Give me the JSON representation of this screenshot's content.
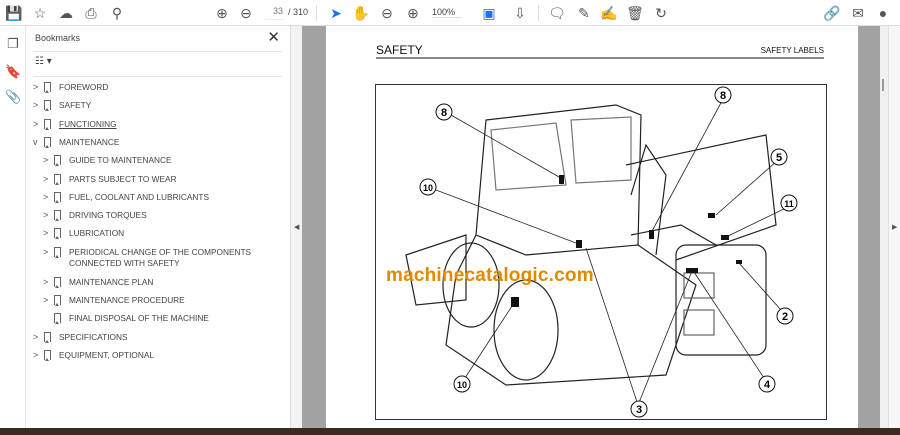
{
  "toolbar": {
    "icons": [
      "save-icon",
      "bookmark-star-icon",
      "upload-cloud-icon",
      "print-icon",
      "search-zoom-icon",
      "page-up-icon",
      "page-down-icon",
      "select-cursor-icon",
      "hand-icon",
      "zoom-out-icon",
      "zoom-in-icon",
      "fit-page-icon",
      "scroll-mode-icon",
      "comment-icon",
      "highlight-pen-icon",
      "sign-icon",
      "delete-icon",
      "rotate-icon",
      "share-link-icon",
      "email-icon",
      "account-icon"
    ],
    "current_page": "33",
    "total_pages": "/ 310",
    "zoom": "100%"
  },
  "bookmarks": {
    "title": "Bookmarks",
    "items": [
      {
        "label": "FOREWORD",
        "level": 0,
        "expand": ">"
      },
      {
        "label": "SAFETY",
        "level": 0,
        "expand": ">"
      },
      {
        "label": "FUNCTIONING",
        "level": 0,
        "expand": ">"
      },
      {
        "label": "MAINTENANCE",
        "level": 0,
        "expand": "v"
      },
      {
        "label": "GUIDE TO MAINTENANCE",
        "level": 1,
        "expand": ">"
      },
      {
        "label": "PARTS SUBJECT TO WEAR",
        "level": 1,
        "expand": ">"
      },
      {
        "label": "FUEL, COOLANT AND LUBRICANTS",
        "level": 1,
        "expand": ">"
      },
      {
        "label": "DRIVING TORQUES",
        "level": 1,
        "expand": ">"
      },
      {
        "label": "LUBRICATION",
        "level": 1,
        "expand": ">"
      },
      {
        "label": "PERIODICAL CHANGE OF THE COMPONENTS",
        "label2": "CONNECTED WITH SAFETY",
        "level": 1,
        "expand": ">"
      },
      {
        "label": "MAINTENANCE PLAN",
        "level": 1,
        "expand": ">"
      },
      {
        "label": "MAINTENANCE PROCEDURE",
        "level": 1,
        "expand": ">"
      },
      {
        "label": "FINAL DISPOSAL OF THE MACHINE",
        "level": 1,
        "expand": ""
      },
      {
        "label": "SPECIFICATIONS",
        "level": 0,
        "expand": ">"
      },
      {
        "label": "EQUIPMENT, OPTIONAL",
        "level": 0,
        "expand": ">"
      }
    ]
  },
  "document": {
    "header_title": "SAFETY",
    "header_right": "SAFETY LABELS",
    "watermark": "machinecatalogic.com",
    "callouts": [
      "8",
      "8",
      "10",
      "5",
      "11",
      "2",
      "10",
      "4",
      "3"
    ]
  }
}
